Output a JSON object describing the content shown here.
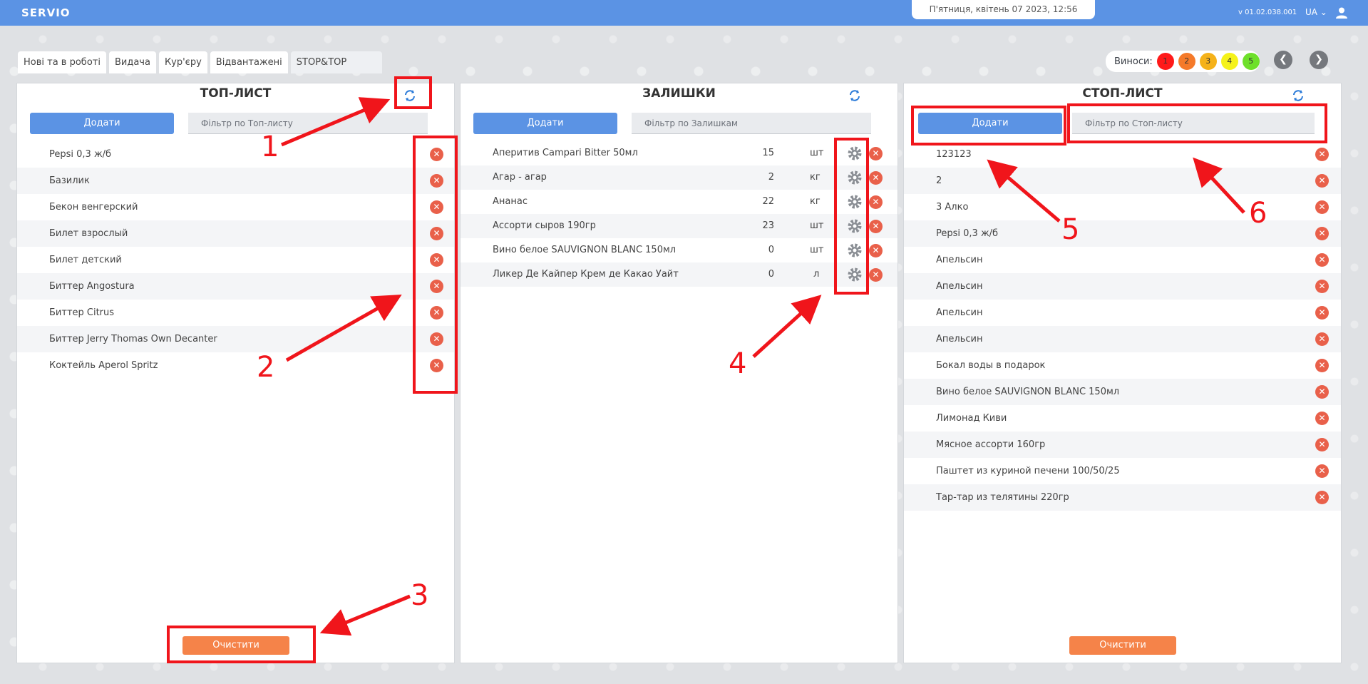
{
  "topbar": {
    "logo": "SERVIO",
    "datetime": "П'ятниця, квітень 07 2023, 12:56",
    "version": "v 01.02.038.001",
    "lang": "UA ⌄",
    "user_icon": "user-icon"
  },
  "tabs": [
    {
      "label": "Нові та в роботі"
    },
    {
      "label": "Видача"
    },
    {
      "label": "Кур'єру"
    },
    {
      "label": "Відвантажені"
    },
    {
      "label": "STOP&TOP"
    }
  ],
  "vynosy": {
    "label": "Виноси:",
    "badges": [
      {
        "label": "1",
        "color": "#ff1a1a"
      },
      {
        "label": "2",
        "color": "#f57a2a"
      },
      {
        "label": "3",
        "color": "#f5b21a"
      },
      {
        "label": "4",
        "color": "#f5f21a"
      },
      {
        "label": "5",
        "color": "#6ee02a"
      }
    ],
    "prev_icon": "chevron-left-icon",
    "next_icon": "chevron-right-icon"
  },
  "top_list": {
    "title": "ТОП-ЛИСТ",
    "add_label": "Додати",
    "filter_placeholder": "Фільтр по Топ-листу",
    "items": [
      "Pepsi 0,3 ж/б",
      "Базилик",
      "Бекон венгерский",
      "Билет взрослый",
      "Билет детский",
      "Биттер Angostura",
      "Биттер Citrus",
      "Биттер Jerry Thomas Own Decanter",
      "Коктейль Aperol Spritz"
    ],
    "clear_label": "Очистити"
  },
  "stock": {
    "title": "ЗАЛИШКИ",
    "add_label": "Додати",
    "filter_placeholder": "Фільтр по Залишкам",
    "items": [
      {
        "name": "Аперитив Campari Bitter 50мл",
        "qty": "15",
        "unit": "шт"
      },
      {
        "name": "Агар - агар",
        "qty": "2",
        "unit": "кг"
      },
      {
        "name": "Ананас",
        "qty": "22",
        "unit": "кг"
      },
      {
        "name": "Ассорти сыров 190гр",
        "qty": "23",
        "unit": "шт"
      },
      {
        "name": "Вино белое SAUVIGNON BLANC 150мл",
        "qty": "0",
        "unit": "шт"
      },
      {
        "name": "Ликер Де Кайпер Крем де Какао Уайт",
        "qty": "0",
        "unit": "л"
      }
    ]
  },
  "stop_list": {
    "title": "СТОП-ЛИСТ",
    "add_label": "Додати",
    "filter_placeholder": "Фільтр по Стоп-листу",
    "items": [
      "123123",
      "2",
      "3 Алко",
      "Pepsi 0,3 ж/б",
      "Апельсин",
      "Апельсин",
      "Апельсин",
      "Апельсин",
      "Бокал воды в подарок",
      "Вино белое SAUVIGNON BLANC 150мл",
      "Лимонад Киви",
      "Мясное ассорти 160гр",
      "Паштет из куриной печени 100/50/25",
      "Тар-тар из телятины 220гр"
    ],
    "clear_label": "Очистити"
  },
  "annotations": [
    "1",
    "2",
    "3",
    "4",
    "5",
    "6"
  ],
  "colors": {
    "accent": "#5b93e4",
    "delete": "#e9604a",
    "clear": "#f58349",
    "annotation": "#f0151b"
  }
}
